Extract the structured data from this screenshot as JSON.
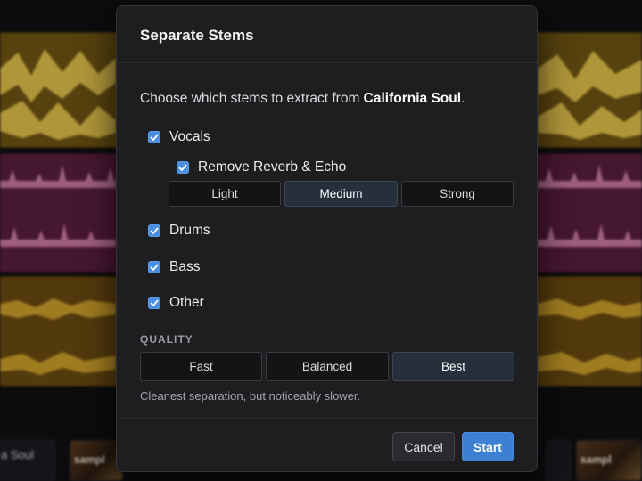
{
  "dialog": {
    "title": "Separate Stems",
    "intro_prefix": "Choose which stems to extract from ",
    "song_name": "California Soul",
    "intro_suffix": "."
  },
  "stems": {
    "vocals": {
      "label": "Vocals",
      "checked": true
    },
    "remove_reverb": {
      "label": "Remove Reverb & Echo",
      "checked": true
    },
    "reverb_strength": {
      "options": [
        "Light",
        "Medium",
        "Strong"
      ],
      "selected": "Medium"
    },
    "drums": {
      "label": "Drums",
      "checked": true
    },
    "bass": {
      "label": "Bass",
      "checked": true
    },
    "other": {
      "label": "Other",
      "checked": true
    }
  },
  "quality": {
    "label": "QUALITY",
    "options": [
      "Fast",
      "Balanced",
      "Best"
    ],
    "selected": "Best",
    "hint": "Cleanest separation, but noticeably slower."
  },
  "footer": {
    "cancel_label": "Cancel",
    "start_label": "Start"
  },
  "background": {
    "clip_left_label": "a Soul",
    "clip_art_label": "sampl"
  },
  "colors": {
    "accent": "#3d7fd2",
    "checkbox": "#4a90e2",
    "vocals_track": "#6e5412",
    "vocals_wave": "#e2c04a",
    "drums_track": "#5a1e3d",
    "drums_wave": "#e08ab8",
    "bass_track": "#6a4a10",
    "bass_wave": "#d8a92e"
  }
}
